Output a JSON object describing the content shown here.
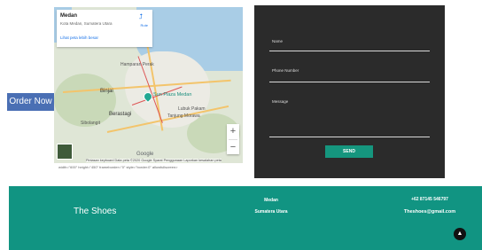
{
  "map": {
    "place_title": "Medan",
    "place_subtitle": "Kota Medan, Sumatera Utara",
    "view_larger_link": "Lihat peta lebih besar",
    "directions_label": "Rute",
    "poi_label": "Sun Plaza Medan",
    "labels": [
      "Hamparan Perak",
      "Binjai",
      "Medan",
      "Lubuk Pakam",
      "Sibolangit",
      "Berastagi",
      "Tanjung Morawa"
    ],
    "google_logo": "Google",
    "attribution": "Pintasan keyboard   Data peta ©2020 Google   Syarat Penggunaan   Laporkan kesalahan peta",
    "zoom_in": "+",
    "zoom_out": "−"
  },
  "embed_code": "width=\"600\" height=\"450\" frameborder=\"0\" style=\"border:0\" allowfullscreen>",
  "order_button": "Order Now",
  "form": {
    "name_label": "Name",
    "phone_label": "Phone Number",
    "message_label": "Message",
    "send_label": "SEND"
  },
  "footer": {
    "brand": "The Shoes",
    "city": "Medan",
    "province": "Sumatera Utara",
    "phone": "+62 87145 546797",
    "email": "Theshoes@gmail.com",
    "to_top": "▲"
  },
  "colors": {
    "footer_bg": "#119482",
    "form_bg": "#2b2b2b",
    "send_bg": "#15967e",
    "order_bg": "#4a6fb4"
  }
}
